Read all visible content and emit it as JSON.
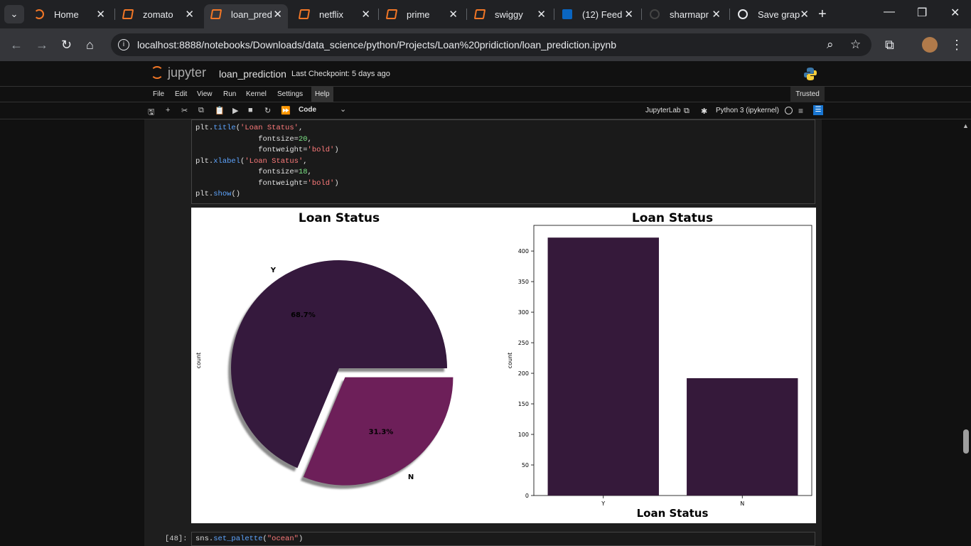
{
  "browser": {
    "tabs": [
      {
        "label": "Home",
        "icon": "jupyter-home-icon"
      },
      {
        "label": "zomato",
        "icon": "notebook-icon"
      },
      {
        "label": "loan_pred",
        "icon": "notebook-icon",
        "active": true
      },
      {
        "label": "netflix",
        "icon": "notebook-icon"
      },
      {
        "label": "prime",
        "icon": "notebook-icon"
      },
      {
        "label": "swiggy",
        "icon": "notebook-icon"
      },
      {
        "label": "(12) Feed",
        "icon": "linkedin-icon"
      },
      {
        "label": "sharmapr",
        "icon": "github-icon"
      },
      {
        "label": "Save grap",
        "icon": "chatgpt-icon"
      }
    ],
    "url": "localhost:8888/notebooks/Downloads/data_science/python/Projects/Loan%20pridiction/loan_prediction.ipynb"
  },
  "jupyter": {
    "logo_text": "jupyter",
    "notebook_name": "loan_prediction",
    "checkpoint": "Last Checkpoint: 5 days ago",
    "menu": [
      "File",
      "Edit",
      "View",
      "Run",
      "Kernel",
      "Settings",
      "Help"
    ],
    "trusted": "Trusted",
    "cell_type": "Code",
    "jupyterlab_label": "JupyterLab",
    "kernel": "Python 3 (ipykernel)"
  },
  "code_cell": {
    "lines": [
      "plt.title('Loan Status',",
      "          fontsize=20,",
      "          fontweight='bold')",
      "plt.xlabel('Loan Status',",
      "           fontsize=18,",
      "           fontweight='bold')",
      "plt.show()"
    ]
  },
  "next_cell": {
    "prompt": "[48]:",
    "code": "sns.set_palette(\"ocean\")"
  },
  "colors": {
    "pie_y": "#35193d",
    "pie_n": "#6d1f59",
    "bar": "#35193a"
  },
  "chart_data": [
    {
      "type": "pie",
      "title": "Loan Status",
      "ylabel": "count",
      "labels": [
        "Y",
        "N"
      ],
      "values": [
        68.7,
        31.3
      ],
      "autopct": [
        "68.7%",
        "31.3%"
      ],
      "explode": [
        0,
        0.1
      ],
      "shadow": true
    },
    {
      "type": "bar",
      "title": "Loan Status",
      "xlabel": "Loan Status",
      "ylabel": "count",
      "categories": [
        "Y",
        "N"
      ],
      "values": [
        422,
        192
      ],
      "ylim": [
        0,
        442
      ],
      "yticks": [
        0,
        50,
        100,
        150,
        200,
        250,
        300,
        350,
        400
      ]
    }
  ]
}
